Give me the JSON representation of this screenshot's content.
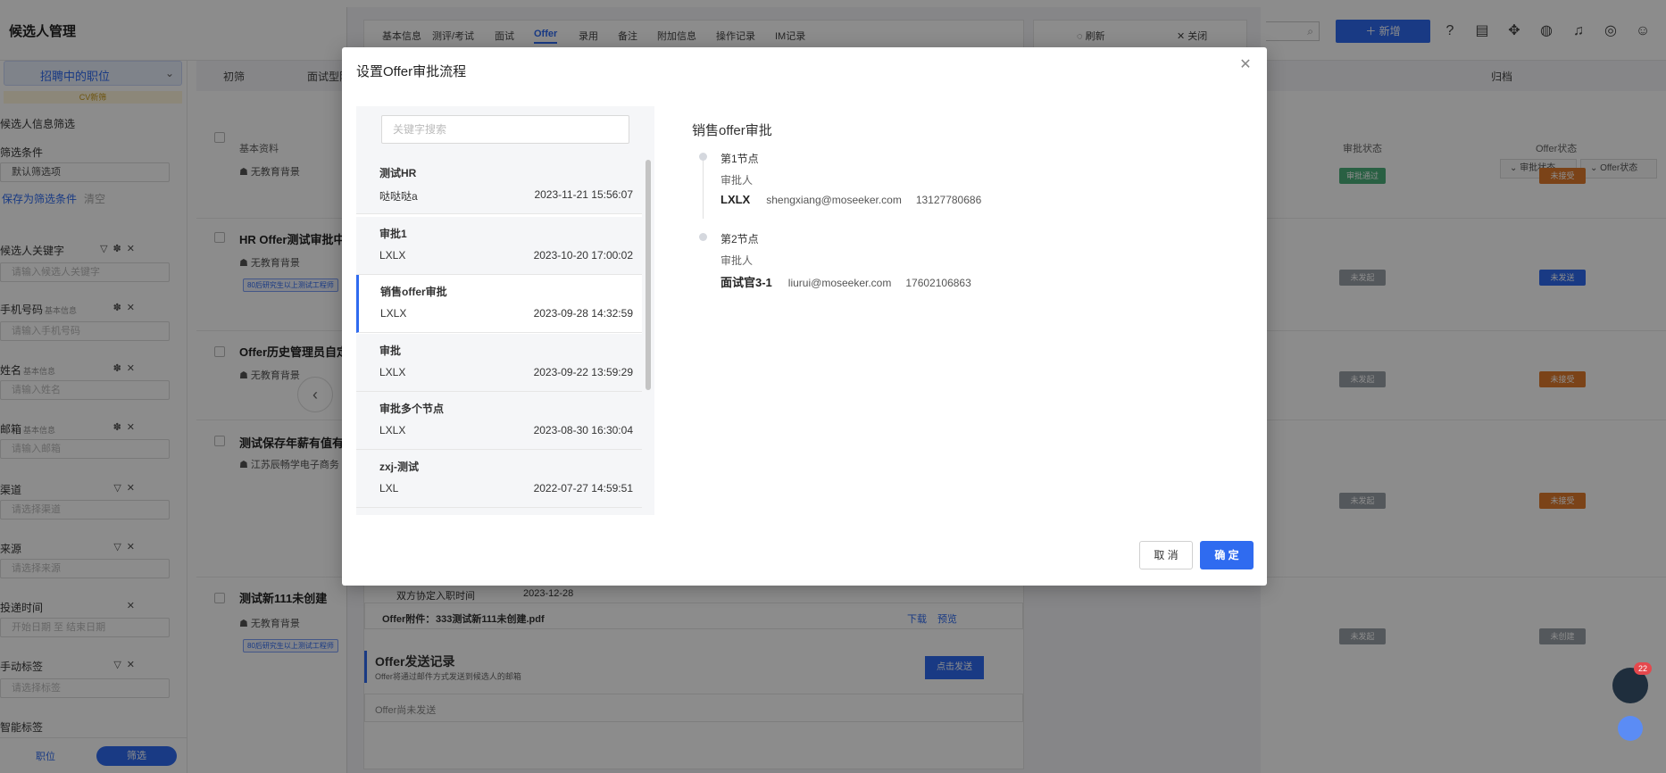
{
  "app": {
    "title": "候选人管理",
    "add_label": "＋ 新增"
  },
  "sidebar": {
    "job_select": "招聘中的职位",
    "cv_tag": "CV新筛",
    "section_title": "候选人信息筛选",
    "filter_label": "筛选条件",
    "default_filter": "默认筛选项",
    "save_filter": "保存为筛选条件",
    "clear": "清空",
    "fields": [
      {
        "label": "候选人关键字",
        "sub": "",
        "placeholder": "请输入候选人关键字"
      },
      {
        "label": "手机号码",
        "sub": "基本信息",
        "placeholder": "请输入手机号码"
      },
      {
        "label": "姓名",
        "sub": "基本信息",
        "placeholder": "请输入姓名"
      },
      {
        "label": "邮箱",
        "sub": "基本信息",
        "placeholder": "请输入邮箱"
      },
      {
        "label": "渠道",
        "sub": "",
        "placeholder": "请选择渠道"
      },
      {
        "label": "来源",
        "sub": "",
        "placeholder": "请选择来源"
      },
      {
        "label": "投递时间",
        "sub": "",
        "placeholder": "开始日期  至  结束日期"
      },
      {
        "label": "手动标签",
        "sub": "",
        "placeholder": "请选择标签"
      },
      {
        "label": "智能标签",
        "sub": "",
        "placeholder": ""
      }
    ],
    "bottom_job": "职位",
    "bottom_filter": "筛选"
  },
  "main": {
    "stages": [
      "初筛",
      "面试型阶"
    ],
    "archive": "归档",
    "col_basic": "基本资料",
    "col_approval": "审批状态",
    "col_offer": "Offer状态",
    "chip_approval": "⌄ 审批状态",
    "chip_offer": "⌄ Offer状态",
    "rows": [
      {
        "title": "",
        "edu": "☗ 无教育背景",
        "approval": "审批通过",
        "approval_color": "#4caf7a",
        "offer": "未接受",
        "offer_color": "#e07a2c"
      },
      {
        "title": "HR Offer测试审批中",
        "edu": "☗ 无教育背景",
        "tag": "80后研究生以上测试工程师",
        "approval": "未发起",
        "approval_color": "#9aa0a8",
        "offer": "未发送",
        "offer_color": "#2f6bf0"
      },
      {
        "title": "Offer历史管理员自定",
        "edu": "☗ 无教育背景",
        "approval": "未发起",
        "approval_color": "#9aa0a8",
        "offer": "未接受",
        "offer_color": "#e07a2c"
      },
      {
        "title": "测试保存年薪有值有",
        "edu": "☗ 江苏辰畅学电子商务",
        "approval": "未发起",
        "approval_color": "#9aa0a8",
        "offer": "未接受",
        "offer_color": "#e07a2c"
      },
      {
        "title": "测试新111未创建",
        "edu": "☗ 无教育背景",
        "tag": "80后研究生以上测试工程师",
        "approval": "未发起",
        "approval_color": "#9aa0a8",
        "offer": "未创建",
        "offer_color": "#9aa0a8"
      }
    ]
  },
  "drawer": {
    "tabs": [
      "基本信息",
      "测评/考试",
      "面试",
      "Offer",
      "录用",
      "备注",
      "附加信息",
      "操作记录",
      "IM记录"
    ],
    "active_tab": "Offer",
    "refresh": "◌ 刷新",
    "close": "✕ 关闭",
    "agreed_date_label": "双方协定入职时间",
    "agreed_date": "2023-12-28",
    "attachment_label": "Offer附件：",
    "attachment_file": "333测试新111未创建.pdf",
    "download": "下载",
    "preview": "预览",
    "send_title": "Offer发送记录",
    "send_sub": "Offer将通过邮件方式发送到候选人的邮箱",
    "send_button": "点击发送",
    "send_empty": "Offer尚未发送"
  },
  "modal": {
    "title": "设置Offer审批流程",
    "search_placeholder": "关键字搜索",
    "flows": [
      {
        "name": "测试HR",
        "owner": "哒哒哒a",
        "date": "2023-11-21 15:56:07"
      },
      {
        "name": "审批1",
        "owner": "LXLX",
        "date": "2023-10-20 17:00:02"
      },
      {
        "name": "销售offer审批",
        "owner": "LXLX",
        "date": "2023-09-28 14:32:59"
      },
      {
        "name": "审批",
        "owner": "LXLX",
        "date": "2023-09-22 13:59:29"
      },
      {
        "name": "审批多个节点",
        "owner": "LXLX",
        "date": "2023-08-30 16:30:04"
      },
      {
        "name": "zxj-测试",
        "owner": "LXL",
        "date": "2022-07-27 14:59:51"
      }
    ],
    "selected_index": 2,
    "detail": {
      "title": "销售offer审批",
      "nodes": [
        {
          "label": "第1节点",
          "role": "审批人",
          "name": "LXLX",
          "email": "shengxiang@moseeker.com",
          "phone": "13127780686"
        },
        {
          "label": "第2节点",
          "role": "审批人",
          "name": "面试官3-1",
          "email": "liurui@moseeker.com",
          "phone": "17602106863"
        }
      ]
    },
    "cancel_label": "取 消",
    "ok_label": "确 定"
  },
  "chat": {
    "badge": "22"
  },
  "colors": {
    "accent": "#2f6bf0",
    "overlay": "rgba(0,0,0,0.45)"
  }
}
